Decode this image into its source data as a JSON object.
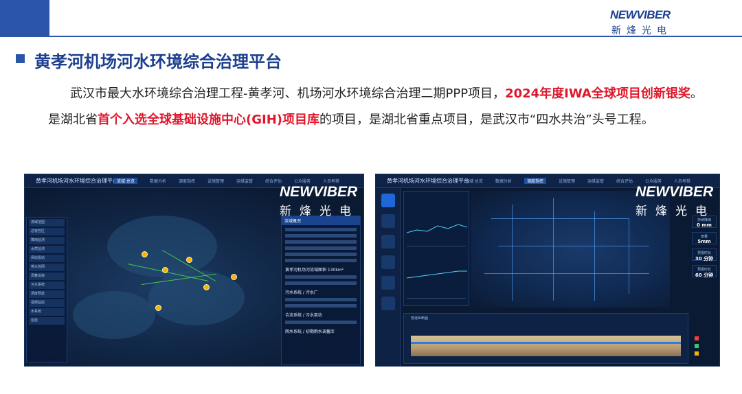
{
  "brand": {
    "logo_text": "NEWVIBER",
    "logo_cn": "新烽光电",
    "watermark_text": "NEWVIBER",
    "watermark_cn": "新烽光电",
    "colors": {
      "primary": "#2a55a8",
      "highlight": "#e0162b",
      "title": "#1d3f8f"
    }
  },
  "heading": {
    "bullet": "■",
    "title": "黄孝河机场河水环境综合治理平台"
  },
  "paragraph": {
    "part1": "武汉市最大水环境综合治理工程-黄孝河、机场河水环境综合治理二期PPP项目，",
    "highlight1": "2024年度IWA全球项目创新银奖",
    "part2": "。是湖北省",
    "highlight2": "首个入选全球基础设施中心(GIH)项目库",
    "part3": "的项目，是湖北省重点项目，是武汉市“四水共治”头号工程。"
  },
  "screenshot_left": {
    "title": "黄孝河机场河水环境综合治理平台",
    "tabs": [
      "流域·总览",
      "数据分析",
      "调度指挥",
      "设施管理",
      "运维监管",
      "综合评估",
      "公众服务",
      "人员考核"
    ],
    "panel_left_rows": [
      "流域范围",
      "总管控区",
      "降雨监测",
      "水质监测",
      "闸站泵站",
      "排水管网",
      "调蓄设施",
      "污水系统",
      "调度预案",
      "视频监控",
      "水系统",
      "巡检"
    ],
    "panel_right_title": "流域概况",
    "panel_right_heads": [
      "黄孝河机场河流域面积 130km²",
      "污水系统 / 污水厂",
      "合流系统 / 污水泵站",
      "雨水系统 / 初期雨水调蓄库"
    ]
  },
  "screenshot_right": {
    "title": "黄孝河机场河水环境综合治理平台",
    "tabs": [
      "流域·总览",
      "数据分析",
      "调度指挥",
      "设施管理",
      "运维监管",
      "综合评估",
      "公众服务",
      "人员考核"
    ],
    "stats": [
      {
        "label": "持续降雨",
        "value": "0 mm"
      },
      {
        "label": "雨量",
        "value": "5mm"
      },
      {
        "label": "预报时长",
        "value": "30 分钟"
      },
      {
        "label": "预报时长",
        "value": "60 分钟"
      }
    ],
    "profile_tab": "管道纵断面"
  }
}
